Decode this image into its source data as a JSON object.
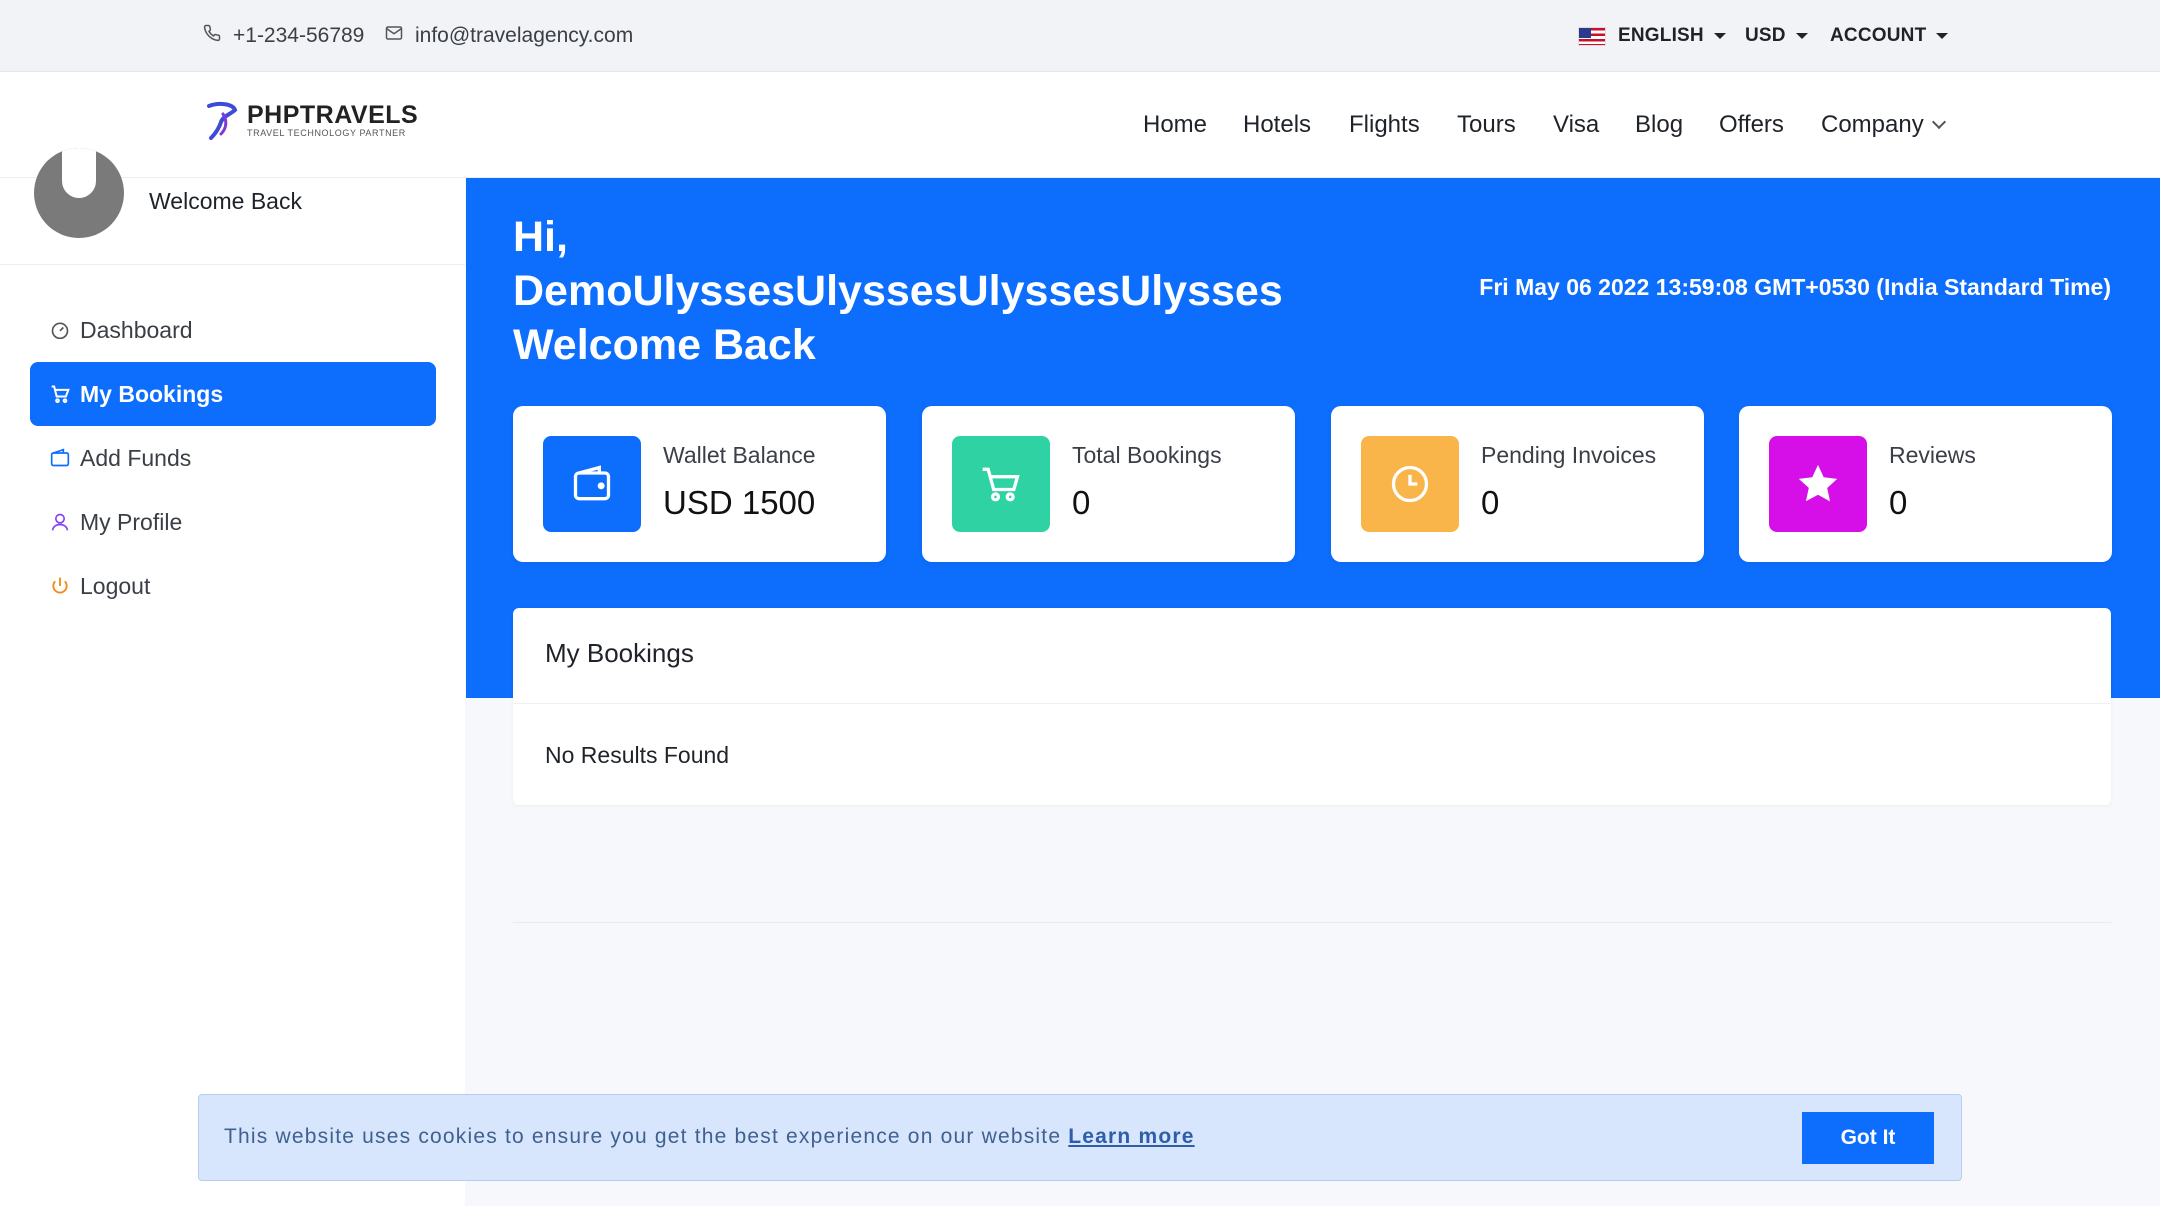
{
  "topbar": {
    "phone": "+1-234-56789",
    "email": "info@travelagency.com",
    "language": "ENGLISH",
    "currency": "USD",
    "account": "ACCOUNT"
  },
  "header": {
    "logo_name": "PHPTRAVELS",
    "logo_tagline": "TRAVEL TECHNOLOGY PARTNER",
    "nav": [
      "Home",
      "Hotels",
      "Flights",
      "Tours",
      "Visa",
      "Blog",
      "Offers",
      "Company"
    ]
  },
  "sidebar": {
    "welcome": "Welcome Back",
    "items": [
      {
        "label": "Dashboard",
        "icon": "dashboard-icon"
      },
      {
        "label": "My Bookings",
        "icon": "cart-icon",
        "active": true
      },
      {
        "label": "Add Funds",
        "icon": "wallet-icon"
      },
      {
        "label": "My Profile",
        "icon": "user-icon"
      },
      {
        "label": "Logout",
        "icon": "power-icon"
      }
    ]
  },
  "hero": {
    "greeting_line1": "Hi,",
    "greeting_name": "DemoUlyssesUlyssesUlyssesUlysses",
    "greeting_line3": "Welcome Back",
    "datetime": "Fri May 06 2022 13:59:08 GMT+0530 (India Standard Time)"
  },
  "cards": [
    {
      "label": "Wallet Balance",
      "value": "USD 1500",
      "icon": "wallet-icon",
      "color": "#0d6efd"
    },
    {
      "label": "Total Bookings",
      "value": "0",
      "icon": "cart-icon",
      "color": "#2fd3a3"
    },
    {
      "label": "Pending Invoices",
      "value": "0",
      "icon": "clock-icon",
      "color": "#f9b54a"
    },
    {
      "label": "Reviews",
      "value": "0",
      "icon": "star-icon",
      "color": "#d60fe8"
    }
  ],
  "bookings": {
    "title": "My Bookings",
    "empty_text": "No Results Found"
  },
  "cookie": {
    "text": "This website uses cookies to ensure you get the best experience on our website",
    "link": "Learn more",
    "button": "Got It"
  },
  "colors": {
    "primary": "#0d6efd"
  }
}
